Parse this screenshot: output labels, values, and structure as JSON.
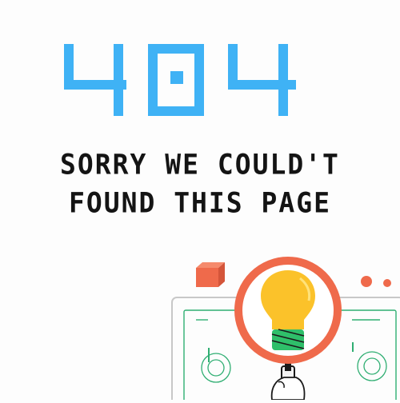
{
  "error": {
    "code": "404",
    "message_line1": "SORRY WE COULD'T",
    "message_line2": "FOUND THIS PAGE"
  },
  "colors": {
    "accent": "#3fb2f5",
    "text": "#141414",
    "magnifier": "#ef6a4b",
    "bulb": "#fbc22a",
    "bulb_base": "#2fbf6a",
    "frame": "#2fae72"
  },
  "icons": {
    "magnifier": "magnifying-glass-icon",
    "bulb": "lightbulb-icon"
  }
}
